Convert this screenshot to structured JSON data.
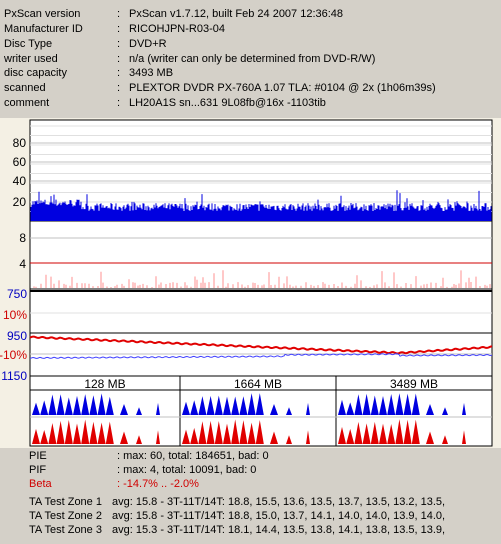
{
  "info": {
    "rows": [
      {
        "label": "PxScan version",
        "value": "PxScan v1.7.12, built Feb 24 2007 12:36:48"
      },
      {
        "label": "Manufacturer ID",
        "value": "RICOHJPN-R03-04"
      },
      {
        "label": "Disc Type",
        "value": "DVD+R"
      },
      {
        "label": "writer used",
        "value": "n/a (writer can only be determined from DVD-R/W)"
      },
      {
        "label": "disc capacity",
        "value": "3493 MB"
      },
      {
        "label": "scanned",
        "value": "PLEXTOR DVDR PX-760A 1.07 TLA: #0104 @ 2x (1h06m39s)"
      },
      {
        "label": "comment",
        "value": "LH20A1S sn...631 9L08fb@16x -1103tib"
      }
    ],
    "separator": ":"
  },
  "graph": {
    "pie_ticks": [
      "80",
      "60",
      "40",
      "20"
    ],
    "pif_ticks": [
      "8",
      "4"
    ],
    "jitter_ticks": [
      "750",
      "10%",
      "950",
      "-10%",
      "1150"
    ],
    "ta_labels": [
      "128 MB",
      "1664 MB",
      "3489 MB"
    ],
    "colors": {
      "pie": "#0000e0",
      "pif": "#ff9090",
      "beta": "#e00000",
      "jitter": "#4040ff",
      "ta_blue": "#0000e0",
      "ta_red": "#e00000",
      "blue_tick": "#0000c0",
      "red_tick": "#d00000"
    }
  },
  "stats": {
    "pie": {
      "label": "PIE",
      "value": ": max: 60, total: 184651, bad: 0"
    },
    "pif": {
      "label": "PIF",
      "value": ": max: 4, total: 10091, bad: 0"
    },
    "beta": {
      "label": "Beta",
      "value": ": -14.7% .. -2.0%"
    },
    "ta_zones": [
      {
        "label": "TA Test Zone 1",
        "value": "avg: 15.8 - 3T-11T/14T: 18.8, 15.5, 13.6, 13.5, 13.7, 13.5, 13.2, 13.5,"
      },
      {
        "label": "TA Test Zone 2",
        "value": "avg: 15.8 - 3T-11T/14T: 18.8, 15.0, 13.7, 14.1, 14.0, 14.0, 13.9, 14.0,"
      },
      {
        "label": "TA Test Zone 3",
        "value": "avg: 15.3 - 3T-11T/14T: 18.1, 14.4, 13.5, 13.8, 14.1, 13.8, 13.5, 13.9,"
      }
    ]
  }
}
